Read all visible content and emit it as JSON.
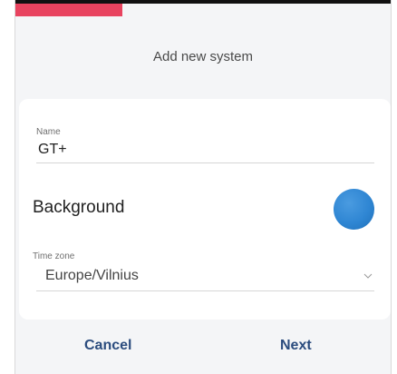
{
  "dialog": {
    "title": "Add new system",
    "progress_fraction": 0.28
  },
  "form": {
    "name": {
      "label": "Name",
      "value": "GT+"
    },
    "background": {
      "label": "Background",
      "color": "#2f86d3"
    },
    "time_zone": {
      "label": "Time zone",
      "value": "Europe/Vilnius"
    }
  },
  "actions": {
    "cancel_label": "Cancel",
    "next_label": "Next"
  },
  "colors": {
    "accent": "#2b4c7e",
    "progress": "#e8435f",
    "swatch": "#2f86d3"
  },
  "icons": {
    "dropdown": "chevron-down-icon"
  }
}
